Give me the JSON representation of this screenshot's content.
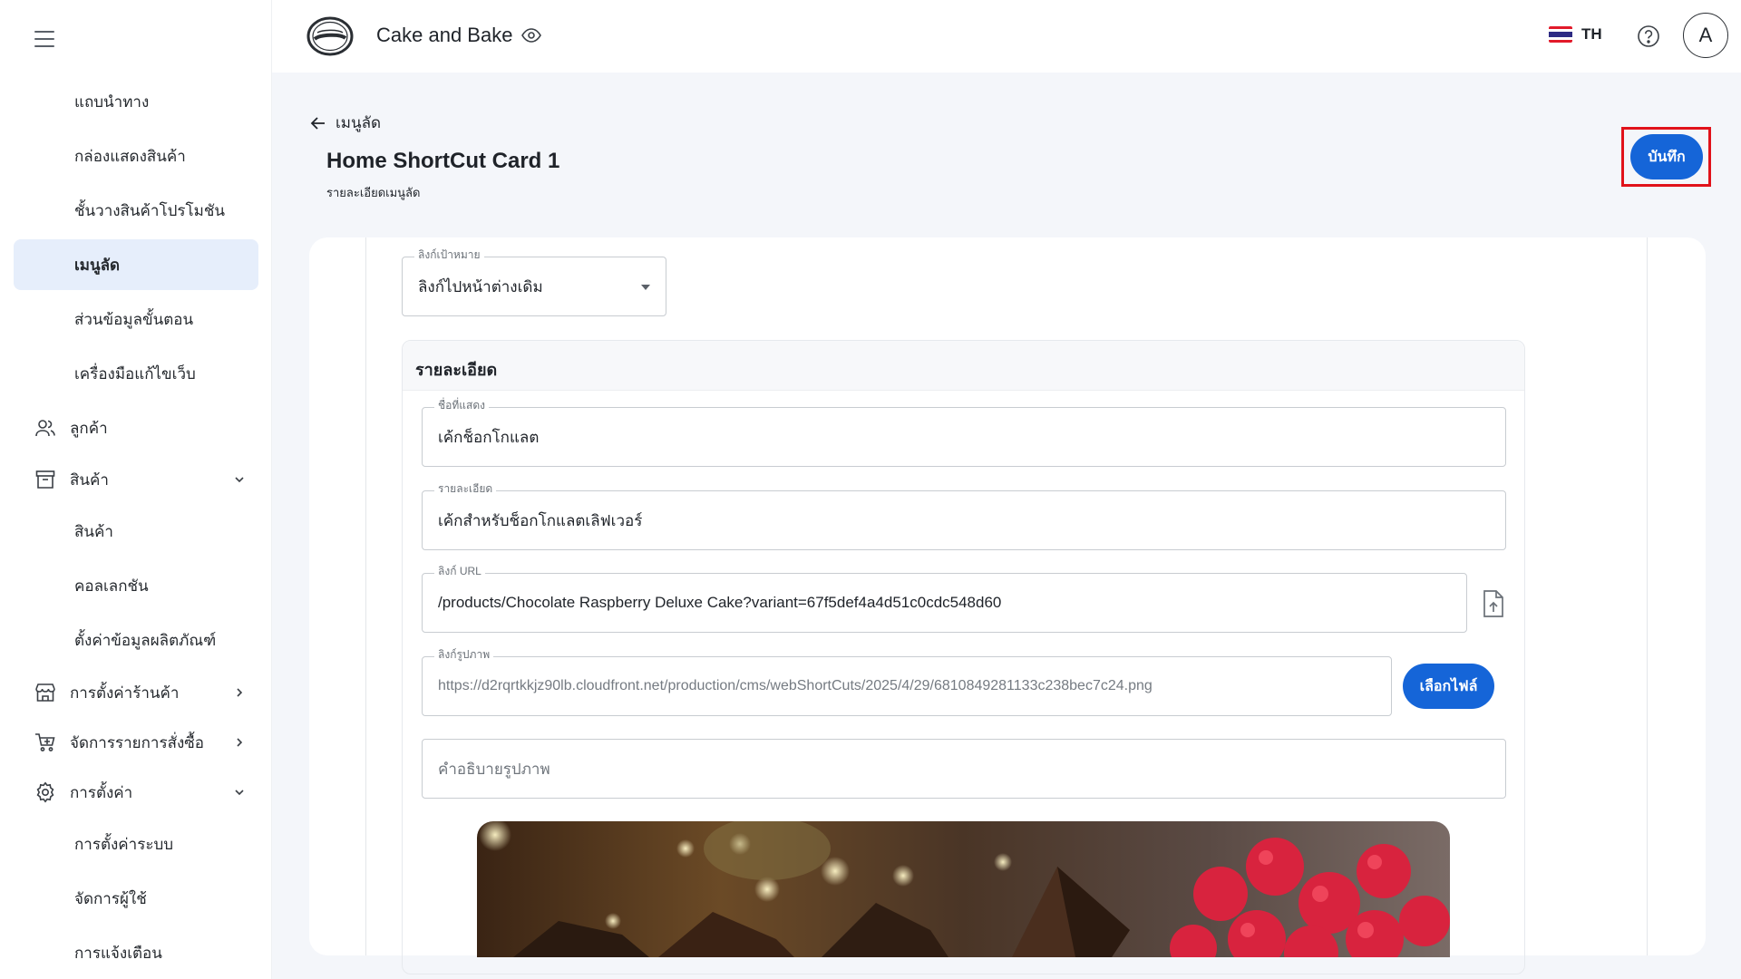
{
  "app": {
    "title": "Cake and Bake",
    "language": "TH",
    "avatar_initial": "A",
    "accent_color": "#1565d8"
  },
  "sidebar": {
    "items": [
      {
        "label": "แถบนำทาง",
        "level": "sub"
      },
      {
        "label": "กล่องแสดงสินค้า",
        "level": "sub"
      },
      {
        "label": "ชั้นวางสินค้าโปรโมชัน",
        "level": "sub"
      },
      {
        "label": "เมนูลัด",
        "level": "sub",
        "active": true
      },
      {
        "label": "ส่วนข้อมูลขั้นตอน",
        "level": "sub"
      },
      {
        "label": "เครื่องมือแก้ไขเว็บ",
        "level": "sub"
      },
      {
        "label": "ลูกค้า",
        "level": "top",
        "icon": "users-icon"
      },
      {
        "label": "สินค้า",
        "level": "top",
        "icon": "archive-box-icon",
        "chevron": "down"
      },
      {
        "label": "สินค้า",
        "level": "sub"
      },
      {
        "label": "คอลเลกชัน",
        "level": "sub"
      },
      {
        "label": "ตั้งค่าข้อมูลผลิตภัณฑ์",
        "level": "sub"
      },
      {
        "label": "การตั้งค่าร้านค้า",
        "level": "top",
        "icon": "storefront-icon",
        "chevron": "right"
      },
      {
        "label": "จัดการรายการสั่งซื้อ",
        "level": "top",
        "icon": "cart-icon",
        "chevron": "right"
      },
      {
        "label": "การตั้งค่า",
        "level": "top",
        "icon": "gear-icon",
        "chevron": "down"
      },
      {
        "label": "การตั้งค่าระบบ",
        "level": "sub"
      },
      {
        "label": "จัดการผู้ใช้",
        "level": "sub"
      },
      {
        "label": "การแจ้งเตือน",
        "level": "sub"
      }
    ]
  },
  "header": {
    "back_label": "เมนูลัด",
    "title": "Home ShortCut Card 1",
    "subtitle": "รายละเอียดเมนูลัด",
    "save_label": "บันทึก"
  },
  "form": {
    "target_link": {
      "label": "ลิงก์เป้าหมาย",
      "value": "ลิงก์ไปหน้าต่างเดิม"
    },
    "section_title": "รายละเอียด",
    "display_name": {
      "label": "ชื่อที่แสดง",
      "value": "เค้กช็อกโกแลต"
    },
    "description": {
      "label": "รายละเอียด",
      "value": "เค้กสำหรับช็อกโกแลตเลิฟเวอร์"
    },
    "link_url": {
      "label": "ลิงก์ URL",
      "value": "/products/Chocolate Raspberry Deluxe Cake?variant=67f5def4a4d51c0cdc548d60"
    },
    "image_link": {
      "label": "ลิงก์รูปภาพ",
      "value": "https://d2rqrtkkjz90lb.cloudfront.net/production/cms/webShortCuts/2025/4/29/6810849281133c238bec7c24.png"
    },
    "choose_file_label": "เลือกไฟล์",
    "image_alt": {
      "placeholder": "คำอธิบายรูปภาพ"
    }
  }
}
